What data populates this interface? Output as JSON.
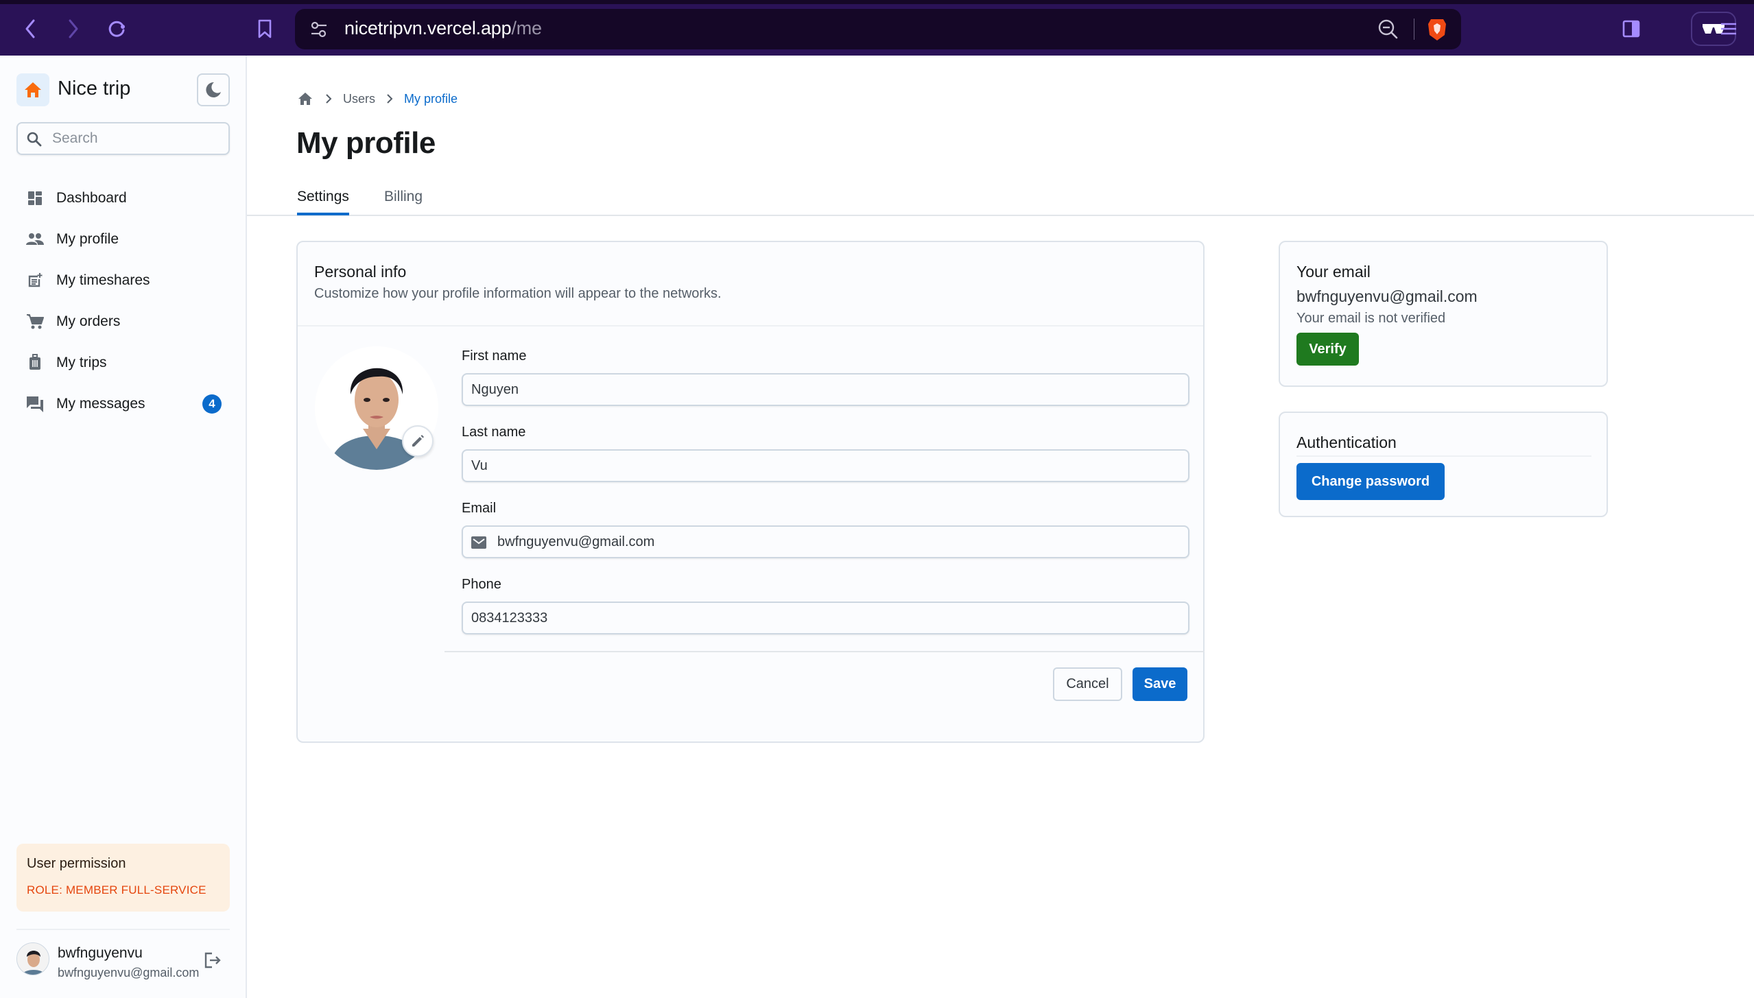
{
  "browser": {
    "url_host": "nicetripvn.vercel.app",
    "url_path": "/me",
    "icons": [
      "back-icon",
      "forward-icon",
      "reload-icon",
      "bookmark-icon",
      "site-settings-icon",
      "zoom-out-icon",
      "brave-shield-icon",
      "sidebar-panel-icon",
      "reader-mode-icon",
      "menu-icon"
    ]
  },
  "sidebar": {
    "brand": "Nice trip",
    "search_placeholder": "Search",
    "items": [
      {
        "label": "Dashboard",
        "icon": "dashboard-icon"
      },
      {
        "label": "My profile",
        "icon": "people-icon"
      },
      {
        "label": "My timeshares",
        "icon": "post-add-icon"
      },
      {
        "label": "My orders",
        "icon": "cart-icon"
      },
      {
        "label": "My trips",
        "icon": "luggage-icon"
      },
      {
        "label": "My messages",
        "icon": "forum-icon",
        "badge": "4"
      }
    ],
    "permission": {
      "title": "User permission",
      "role": "ROLE: MEMBER FULL-SERVICE"
    },
    "user": {
      "name": "bwfnguyenvu",
      "email": "bwfnguyenvu@gmail.com"
    }
  },
  "main": {
    "breadcrumb": [
      "Users",
      "My profile"
    ],
    "title": "My profile",
    "tabs": [
      {
        "label": "Settings",
        "active": true
      },
      {
        "label": "Billing",
        "active": false
      }
    ],
    "personal_info": {
      "title": "Personal info",
      "subtitle": "Customize how your profile information will appear to the networks.",
      "fields": {
        "first_name": {
          "label": "First name",
          "value": "Nguyen"
        },
        "last_name": {
          "label": "Last name",
          "value": "Vu"
        },
        "email": {
          "label": "Email",
          "value": "bwfnguyenvu@gmail.com"
        },
        "phone": {
          "label": "Phone",
          "value": "0834123333"
        }
      },
      "cancel_label": "Cancel",
      "save_label": "Save"
    },
    "email_card": {
      "title": "Your email",
      "email": "bwfnguyenvu@gmail.com",
      "status": "Your email is not verified",
      "verify_label": "Verify"
    },
    "auth_card": {
      "title": "Authentication",
      "change_password_label": "Change password"
    }
  },
  "colors": {
    "primary": "#0b6bcb",
    "success": "#1f7a1f",
    "warning_text": "#e5460e",
    "warning_bg": "#fdf0e1",
    "brand_icon": "#f96b0c",
    "browser_chrome": "#2a1257"
  }
}
